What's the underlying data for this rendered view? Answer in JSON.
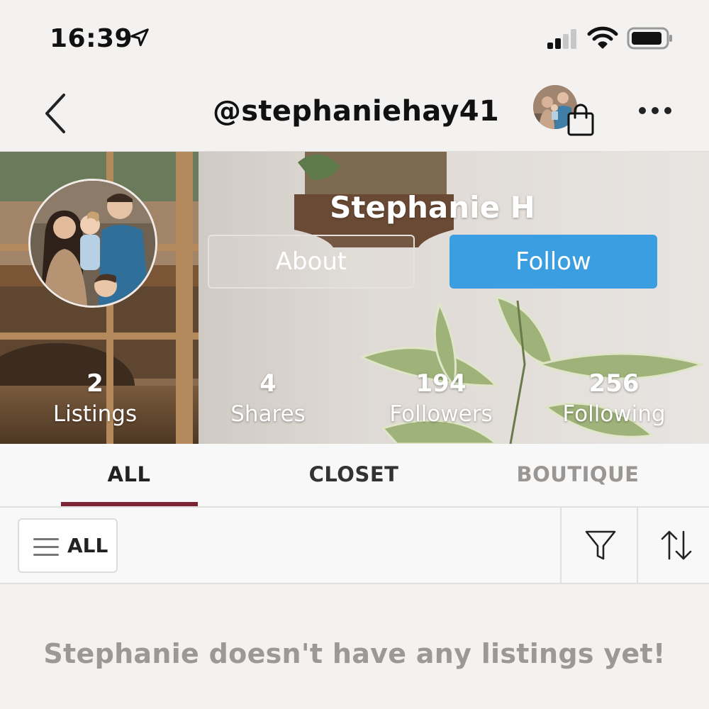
{
  "status_bar": {
    "time": "16:39",
    "icons": [
      "location-arrow-icon",
      "signal-bars-icon",
      "wifi-icon",
      "battery-icon"
    ]
  },
  "nav": {
    "title": "@stephaniehay41",
    "icons": [
      "back-chevron-icon",
      "shopping-bag-icon",
      "more-dots-icon"
    ]
  },
  "profile": {
    "name": "Stephanie H",
    "about_label": "About",
    "follow_label": "Follow",
    "follow_color": "#3a9ee0",
    "stats": [
      {
        "value": "2",
        "label": "Listings"
      },
      {
        "value": "4",
        "label": "Shares"
      },
      {
        "value": "194",
        "label": "Followers"
      },
      {
        "value": "256",
        "label": "Following"
      }
    ]
  },
  "tabs": {
    "items": [
      "ALL",
      "CLOSET",
      "BOUTIQUE"
    ],
    "active": "ALL",
    "indicator_color": "#7b2434"
  },
  "filter_bar": {
    "all_label": "ALL",
    "icons": [
      "hamburger-icon",
      "funnel-filter-icon",
      "sort-arrows-icon"
    ]
  },
  "empty_state": {
    "message": "Stephanie doesn't have any listings yet!"
  }
}
